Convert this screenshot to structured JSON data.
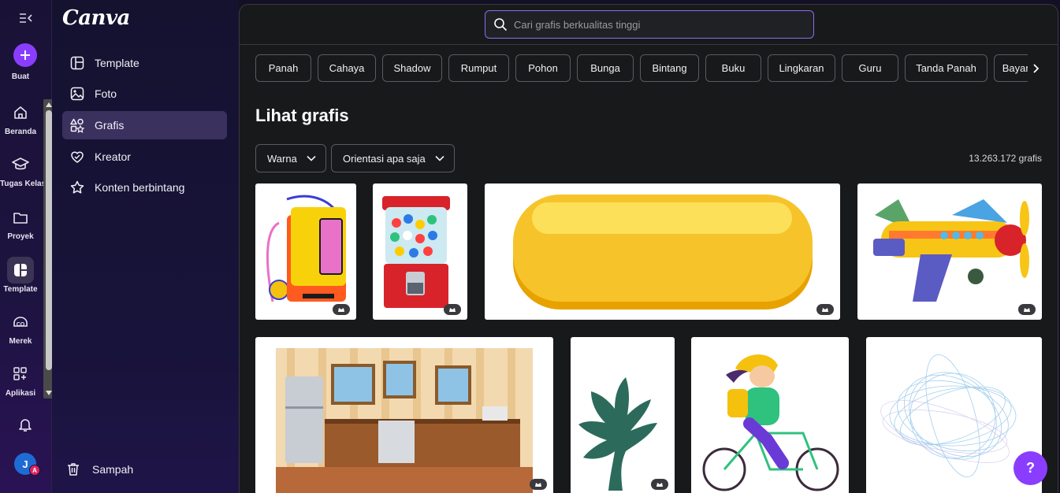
{
  "rail": {
    "create_label": "Buat",
    "items": [
      {
        "label": "Beranda",
        "icon": "home-icon"
      },
      {
        "label": "Tugas Kelas",
        "icon": "graduation-cap-icon"
      },
      {
        "label": "Proyek",
        "icon": "folder-icon"
      },
      {
        "label": "Template",
        "icon": "template-icon"
      },
      {
        "label": "Merek",
        "icon": "brand-icon"
      },
      {
        "label": "Aplikasi",
        "icon": "apps-icon"
      }
    ],
    "avatar_initial": "J",
    "avatar_badge": "A"
  },
  "sidenav": {
    "logo": "Canva",
    "items": [
      {
        "label": "Template",
        "icon": "template-icon"
      },
      {
        "label": "Foto",
        "icon": "photo-icon"
      },
      {
        "label": "Grafis",
        "icon": "shapes-icon"
      },
      {
        "label": "Kreator",
        "icon": "heart-icon"
      },
      {
        "label": "Konten berbintang",
        "icon": "star-icon"
      }
    ],
    "trash_label": "Sampah"
  },
  "search": {
    "placeholder": "Cari grafis berkualitas tinggi"
  },
  "chips": [
    "Panah",
    "Cahaya",
    "Shadow",
    "Rumput",
    "Pohon",
    "Bunga",
    "Bintang",
    "Buku",
    "Lingkaran",
    "Guru",
    "Tanda Panah",
    "Bayangan"
  ],
  "main": {
    "heading": "Lihat grafis",
    "filter_color": "Warna",
    "filter_orientation": "Orientasi apa saja",
    "result_count": "13.263.172 grafis"
  },
  "help_label": "?",
  "colors": {
    "accent": "#8b3dff",
    "panel": "#18191b",
    "active_nav": "#3b315f"
  }
}
